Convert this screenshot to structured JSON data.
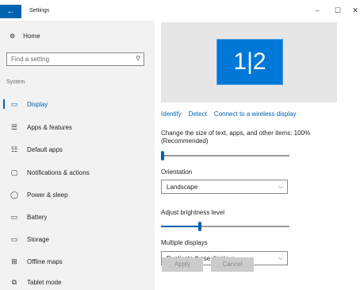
{
  "titlebar": {
    "back_icon": "←",
    "title": "Settings",
    "minimize_icon": "–",
    "maximize_icon": "☐",
    "close_icon": "✕"
  },
  "sidebar": {
    "home": {
      "icon": "⚙",
      "label": "Home"
    },
    "search": {
      "placeholder": "Find a setting",
      "icon": "⚲"
    },
    "group_label": "System",
    "items": [
      {
        "icon": "▭",
        "label": "Display",
        "active": true
      },
      {
        "icon": "☰",
        "label": "Apps & features"
      },
      {
        "icon": "☷",
        "label": "Default apps"
      },
      {
        "icon": "▢",
        "label": "Notifications & actions"
      },
      {
        "icon": "◯",
        "label": "Power & sleep"
      },
      {
        "icon": "▭",
        "label": "Battery"
      },
      {
        "icon": "▭",
        "label": "Storage"
      },
      {
        "icon": "⊞",
        "label": "Offline maps"
      },
      {
        "icon": "⧉",
        "label": "Tablet mode"
      }
    ]
  },
  "main": {
    "monitor_label": "1|2",
    "links": [
      "Identify",
      "Detect",
      "Connect to a wireless display"
    ],
    "scale_label": "Change the size of text, apps, and other items: 100% (Recommended)",
    "scale_level": 0.0,
    "orientation_label": "Orientation",
    "orientation_value": "Landscape",
    "brightness_label": "Adjust brightness level",
    "brightness_level": 0.3,
    "multiple_label": "Multiple displays",
    "multiple_value": "Duplicate these displays",
    "dropdown_icon": "⌵",
    "apply_label": "Apply",
    "cancel_label": "Cancel"
  },
  "colors": {
    "accent": "#0063b1",
    "monitor": "#0078d7",
    "sidebar_bg": "#f2f2f2",
    "preview_bg": "#e6e6e6"
  }
}
